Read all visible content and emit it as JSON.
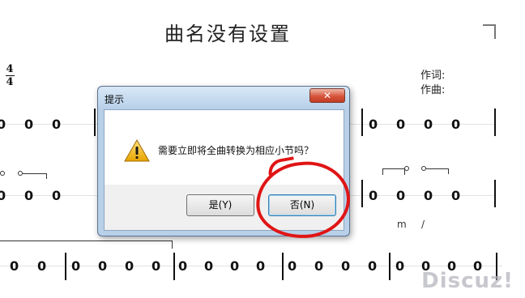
{
  "score": {
    "title": "曲名没有设置",
    "time_signature": {
      "top": "4",
      "bottom": "4"
    },
    "lyricist_label": "作词:",
    "composer_label": "作曲:",
    "rows": [
      {
        "left": [
          "0",
          "0",
          "0"
        ],
        "right": [
          "0",
          "0",
          "0",
          "0"
        ]
      },
      {
        "left": [
          "0",
          "0",
          "0"
        ],
        "right": [
          "0",
          "0",
          "0",
          "0"
        ]
      },
      {
        "measures": [
          [
            "0",
            "0"
          ],
          [
            "0",
            "0",
            "0",
            "0"
          ],
          [
            "0",
            "0",
            "0",
            "0"
          ],
          [
            "0",
            "0",
            "0",
            "0"
          ],
          [
            "0",
            "0",
            "0",
            "0"
          ]
        ]
      }
    ],
    "marks": {
      "m": "m",
      "slash": "/"
    }
  },
  "dialog": {
    "title": "提示",
    "close_label": "✕",
    "message": "需要立即将全曲转换为相应小节吗？",
    "icon": "warning-icon",
    "yes_label": "是(Y)",
    "no_label": "否(N)",
    "annotation_color": "#e01515"
  },
  "watermark": "Discuz!"
}
